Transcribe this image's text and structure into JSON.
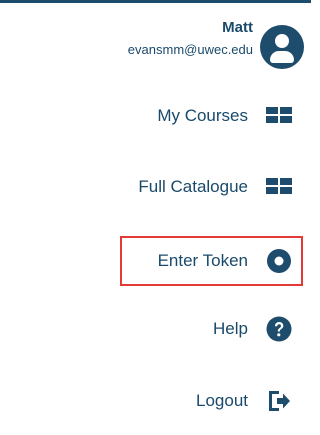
{
  "user": {
    "name": "Matt",
    "email": "evansmm@uwec.edu",
    "avatar_icon": "user-avatar-icon"
  },
  "menu": {
    "items": [
      {
        "label": "My Courses",
        "icon": "grid-icon"
      },
      {
        "label": "Full Catalogue",
        "icon": "grid-icon"
      },
      {
        "label": "Enter Token",
        "icon": "circle-dot-icon",
        "highlighted": true
      },
      {
        "label": "Help",
        "icon": "question-circle-icon"
      },
      {
        "label": "Logout",
        "icon": "logout-icon"
      }
    ]
  },
  "colors": {
    "primary": "#1e4c6d",
    "text": "#1a4a6b",
    "highlight_border": "#e53935",
    "background": "#ffffff"
  }
}
